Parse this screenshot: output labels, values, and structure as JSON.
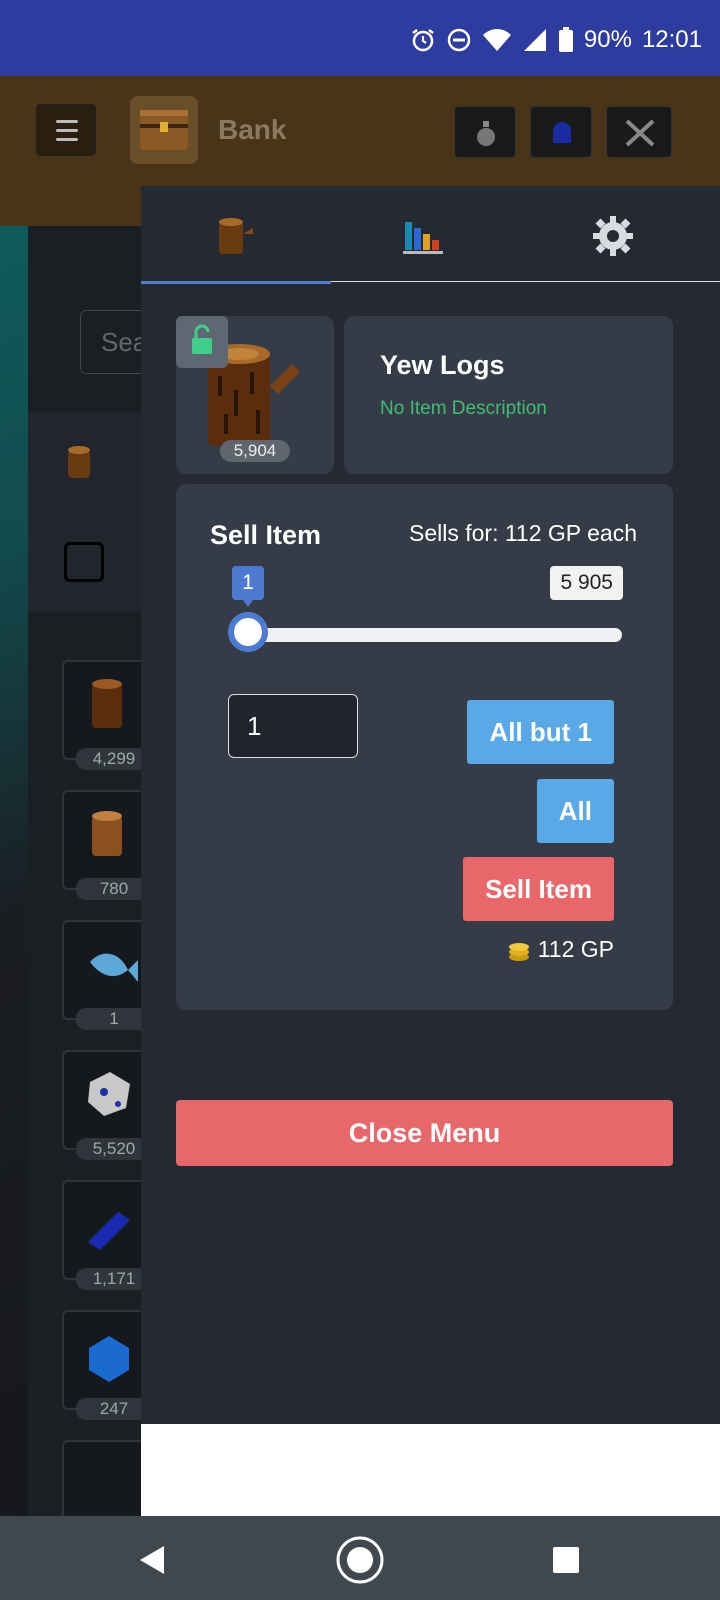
{
  "status_bar": {
    "battery": "90%",
    "time": "12:01"
  },
  "header": {
    "title": "Bank"
  },
  "background": {
    "search_placeholder": "Sea",
    "bank_items": [
      {
        "count": "4,299",
        "icon": "oak-log-icon"
      },
      {
        "count": "780",
        "icon": "willow-log-icon"
      },
      {
        "count": "1",
        "icon": "fish-icon"
      },
      {
        "count": "5,520",
        "icon": "ore-icon"
      },
      {
        "count": "1,171",
        "icon": "bar-icon"
      },
      {
        "count": "247",
        "icon": "gem-icon"
      }
    ]
  },
  "drawer": {
    "tabs": [
      {
        "icon": "log-icon"
      },
      {
        "icon": "stats-chart-icon"
      },
      {
        "icon": "gear-icon"
      }
    ],
    "item": {
      "name": "Yew Logs",
      "description": "No Item Description",
      "count": "5,904"
    },
    "sell": {
      "title": "Sell Item",
      "price_text": "Sells for: 112 GP each",
      "slider_min": "1",
      "slider_max": "5 905",
      "quantity": "1",
      "all_but_one_label": "All but 1",
      "all_label": "All",
      "sell_label": "Sell Item",
      "total_gp": "112 GP"
    },
    "close_label": "Close Menu"
  },
  "colors": {
    "accent": "#4e7bd1",
    "button_blue": "#5aa9e6",
    "button_red": "#e7676a",
    "description_green": "#3fbf72"
  }
}
